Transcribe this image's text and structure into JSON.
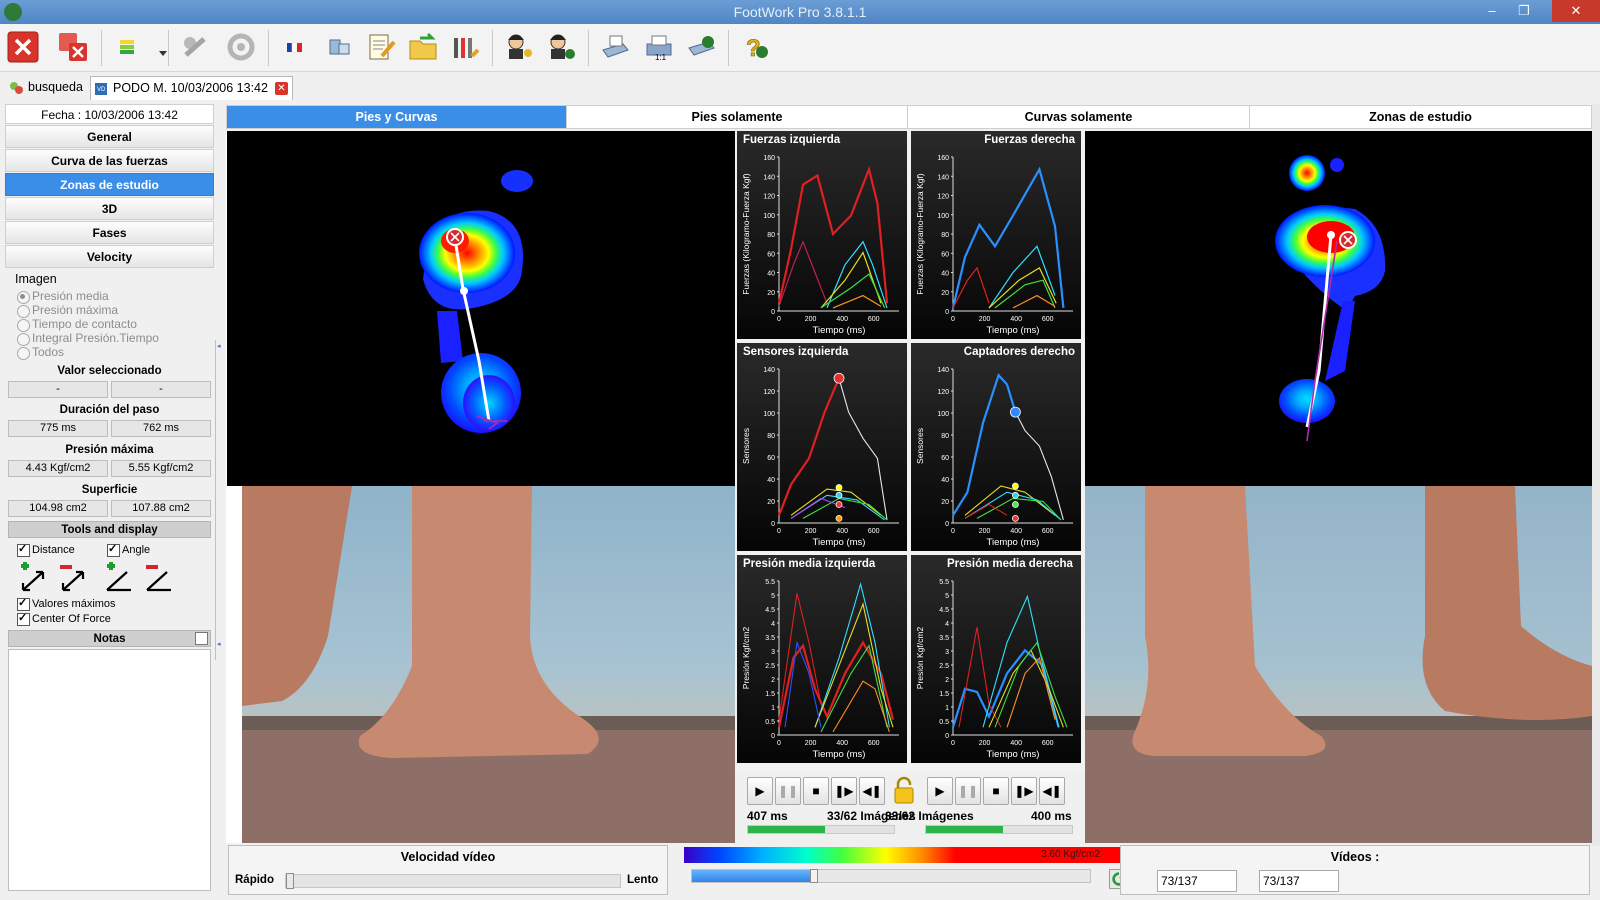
{
  "window": {
    "title": "FootWork Pro 3.8.1.1",
    "controls": [
      "–",
      "❐",
      "✕"
    ]
  },
  "toolbar": {
    "icons": [
      "close-file-icon",
      "close-all-icon",
      "color-palette-icon",
      "dropdown-arrow-icon",
      "disabled-tool-icon",
      "disabled-refresh-icon",
      "french-flag-icon",
      "device-icon",
      "edit-document-icon",
      "open-folder-icon",
      "settings-tools-icon",
      "user-key-icon",
      "user-email-icon",
      "scanner-icon",
      "print-icon",
      "email-icon",
      "help-icon"
    ]
  },
  "doc_tabs": [
    {
      "label": "busqueda"
    },
    {
      "label": "PODO M. 10/03/2006 13:42",
      "close": "✕"
    }
  ],
  "left": {
    "date": "Fecha : 10/03/2006 13:42",
    "nav": [
      "General",
      "Curva de las fuerzas",
      "Zonas de estudio",
      "3D",
      "Fases",
      "Velocity"
    ],
    "selected_nav": "Zonas de estudio",
    "image_group": {
      "title": "Imagen",
      "options": [
        "Presión media",
        "Presión máxima",
        "Tiempo de contacto",
        "Integral Presión.Tiempo",
        "Todos"
      ],
      "selected": "Presión media"
    },
    "valor_seleccionado": {
      "label": "Valor seleccionado",
      "left": "-",
      "right": "-"
    },
    "duracion": {
      "label": "Duración del paso",
      "left": "775 ms",
      "right": "762 ms"
    },
    "presion_maxima": {
      "label": "Presión máxima",
      "left": "4.43 Kgf/cm2",
      "right": "5.55 Kgf/cm2"
    },
    "superficie": {
      "label": "Superficie",
      "left": "104.98 cm2",
      "right": "107.88 cm2"
    },
    "tools": {
      "title": "Tools and display",
      "distance": "Distance",
      "angle": "Angle",
      "valores_maximos": "Valores máximos",
      "center_of_force": "Center Of Force"
    },
    "notas": "Notas"
  },
  "view_tabs": [
    "Pies y Curvas",
    "Pies solamente",
    "Curvas solamente",
    "Zonas de estudio"
  ],
  "active_view_tab": "Pies y Curvas",
  "charts": {
    "fuerzas_izq": {
      "title": "Fuerzas izquierda",
      "ylabel": "Fuerzas (Kilogramo-Fuerza Kgf)",
      "xlabel": "Tiempo (ms)",
      "yticks": [
        "160",
        "140",
        "120",
        "100",
        "80",
        "60",
        "40",
        "20",
        "0"
      ],
      "xticks": [
        "0",
        "200",
        "400",
        "600"
      ]
    },
    "fuerzas_der": {
      "title": "Fuerzas derecha",
      "ylabel": "Fuerzas (Kilogramo-Fuerza Kgf)",
      "xlabel": "Tiempo (ms)",
      "yticks": [
        "160",
        "140",
        "120",
        "100",
        "80",
        "60",
        "40",
        "20",
        "0"
      ],
      "xticks": [
        "0",
        "200",
        "400",
        "600"
      ]
    },
    "sensores_izq": {
      "title": "Sensores izquierda",
      "ylabel": "Sensores",
      "xlabel": "Tiempo (ms)",
      "yticks": [
        "140",
        "120",
        "100",
        "80",
        "60",
        "40",
        "20",
        "0"
      ],
      "xticks": [
        "0",
        "200",
        "400",
        "600"
      ]
    },
    "captadores_der": {
      "title": "Captadores derecho",
      "ylabel": "Sensores",
      "xlabel": "Tiempo (ms)",
      "yticks": [
        "140",
        "120",
        "100",
        "80",
        "60",
        "40",
        "20",
        "0"
      ],
      "xticks": [
        "0",
        "200",
        "400",
        "600"
      ]
    },
    "presion_izq": {
      "title": "Presión media izquierda",
      "ylabel": "Presión Kgf/cm2",
      "xlabel": "Tiempo (ms)",
      "yticks": [
        "5.5",
        "5",
        "4.5",
        "4",
        "3.5",
        "3",
        "2.5",
        "2",
        "1.5",
        "1",
        "0.5",
        "0"
      ],
      "xticks": [
        "0",
        "200",
        "400",
        "600"
      ]
    },
    "presion_der": {
      "title": "Presión media derecha",
      "ylabel": "Presión Kgf/cm2",
      "xlabel": "Tiempo (ms)",
      "yticks": [
        "5.5",
        "5",
        "4.5",
        "4",
        "3.5",
        "3",
        "2.5",
        "2",
        "1.5",
        "1",
        "0.5",
        "0"
      ],
      "xticks": [
        "0",
        "200",
        "400",
        "600"
      ]
    }
  },
  "playback": {
    "left_time": "407 ms",
    "left_frames": "33/62 Imágenes",
    "right_frames": "33/62 Imágenes",
    "right_time": "400 ms",
    "left_progress": 0.53,
    "right_progress": 0.53,
    "buttons": [
      "play-icon",
      "pause-icon",
      "stop-icon",
      "step-forward-icon",
      "step-back-icon"
    ]
  },
  "bottom": {
    "velocidad": {
      "title": "Velocidad vídeo",
      "rapido": "Rápido",
      "lento": "Lento",
      "value": 0.0
    },
    "colorbar": {
      "max_label": "3.60 Kgf/cm2",
      "slider": 0.3
    },
    "videos": {
      "title": "Vídeos :",
      "left": "73/137",
      "right": "73/137"
    }
  },
  "colors": {
    "accent": "#3b8ee8",
    "progress": "#2db449",
    "close_red": "#d7342b"
  }
}
